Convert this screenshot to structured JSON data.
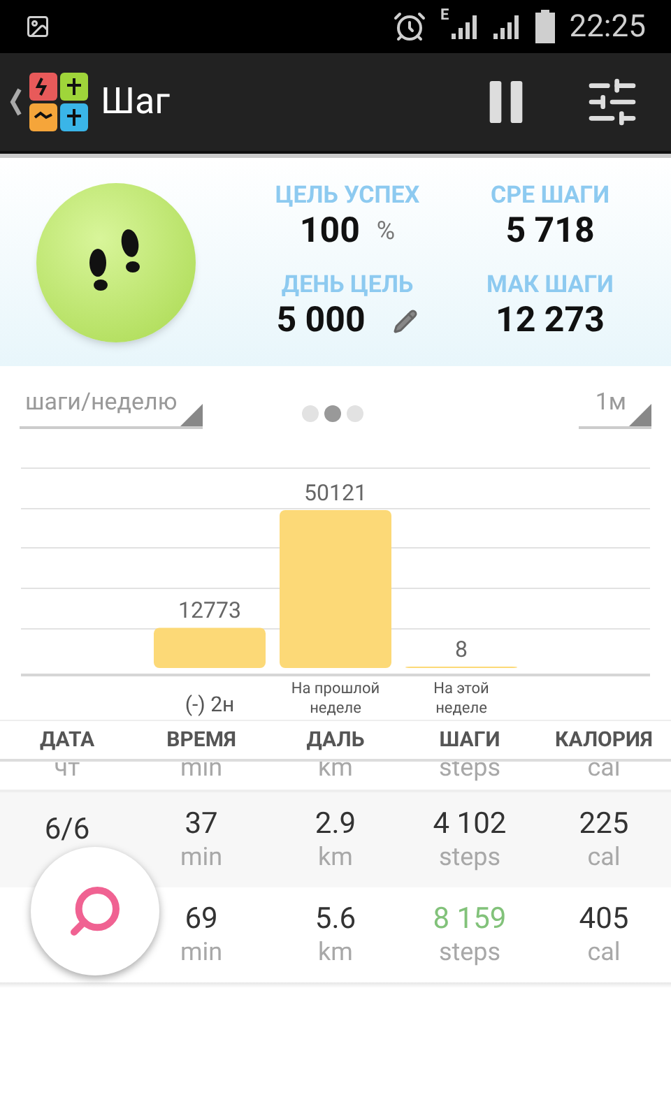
{
  "status_bar": {
    "time": "22:25",
    "network": "E"
  },
  "app_bar": {
    "title": "Шаг"
  },
  "stats": [
    {
      "label": "ЦЕЛЬ УСПЕХ",
      "value": "100",
      "unit": "%",
      "editable": false
    },
    {
      "label": "СРЕ ШАГИ",
      "value": "5 718",
      "editable": false
    },
    {
      "label": "ДЕНЬ ЦЕЛЬ",
      "value": "5 000",
      "editable": true
    },
    {
      "label": "МАК ШАГИ",
      "value": "12 273",
      "editable": false
    }
  ],
  "selectors": [
    {
      "value": "шаги/неделю"
    },
    {
      "value": "1м"
    }
  ],
  "pages": [
    {
      "selected": false
    },
    {
      "selected": true
    },
    {
      "selected": false
    }
  ],
  "chart_data": {
    "type": "bar",
    "categories": [
      "(-) 2н",
      "На прошлой неделе",
      "На этой неделе"
    ],
    "values": [
      12773,
      50121,
      8
    ],
    "data_labels": true
  },
  "table": {
    "columns": [
      "ДАТА",
      "ВРЕМЯ",
      "ДАЛЬ",
      "ШАГИ",
      "КАЛОРИЯ"
    ],
    "rows": [
      {
        "cells": [
          {
            "sub": "чт"
          },
          {
            "sub": "min"
          },
          {
            "sub": "km"
          },
          {
            "sub": "steps"
          },
          {
            "sub": "cal"
          }
        ],
        "partial": true
      },
      {
        "cells": [
          {
            "value": "6/6"
          },
          {
            "value": "37",
            "sub": "min"
          },
          {
            "value": "2.9",
            "sub": "km"
          },
          {
            "value": "4 102",
            "sub": "steps",
            "goal_met": false
          },
          {
            "value": "225",
            "sub": "cal"
          }
        ],
        "partial": false
      },
      {
        "cells": [
          {},
          {
            "value": "69",
            "sub": "min"
          },
          {
            "value": "5.6",
            "sub": "km"
          },
          {
            "value": "8 159",
            "sub": "steps",
            "goal_met": true
          },
          {
            "value": "405",
            "sub": "cal"
          }
        ],
        "partial": false
      }
    ]
  }
}
